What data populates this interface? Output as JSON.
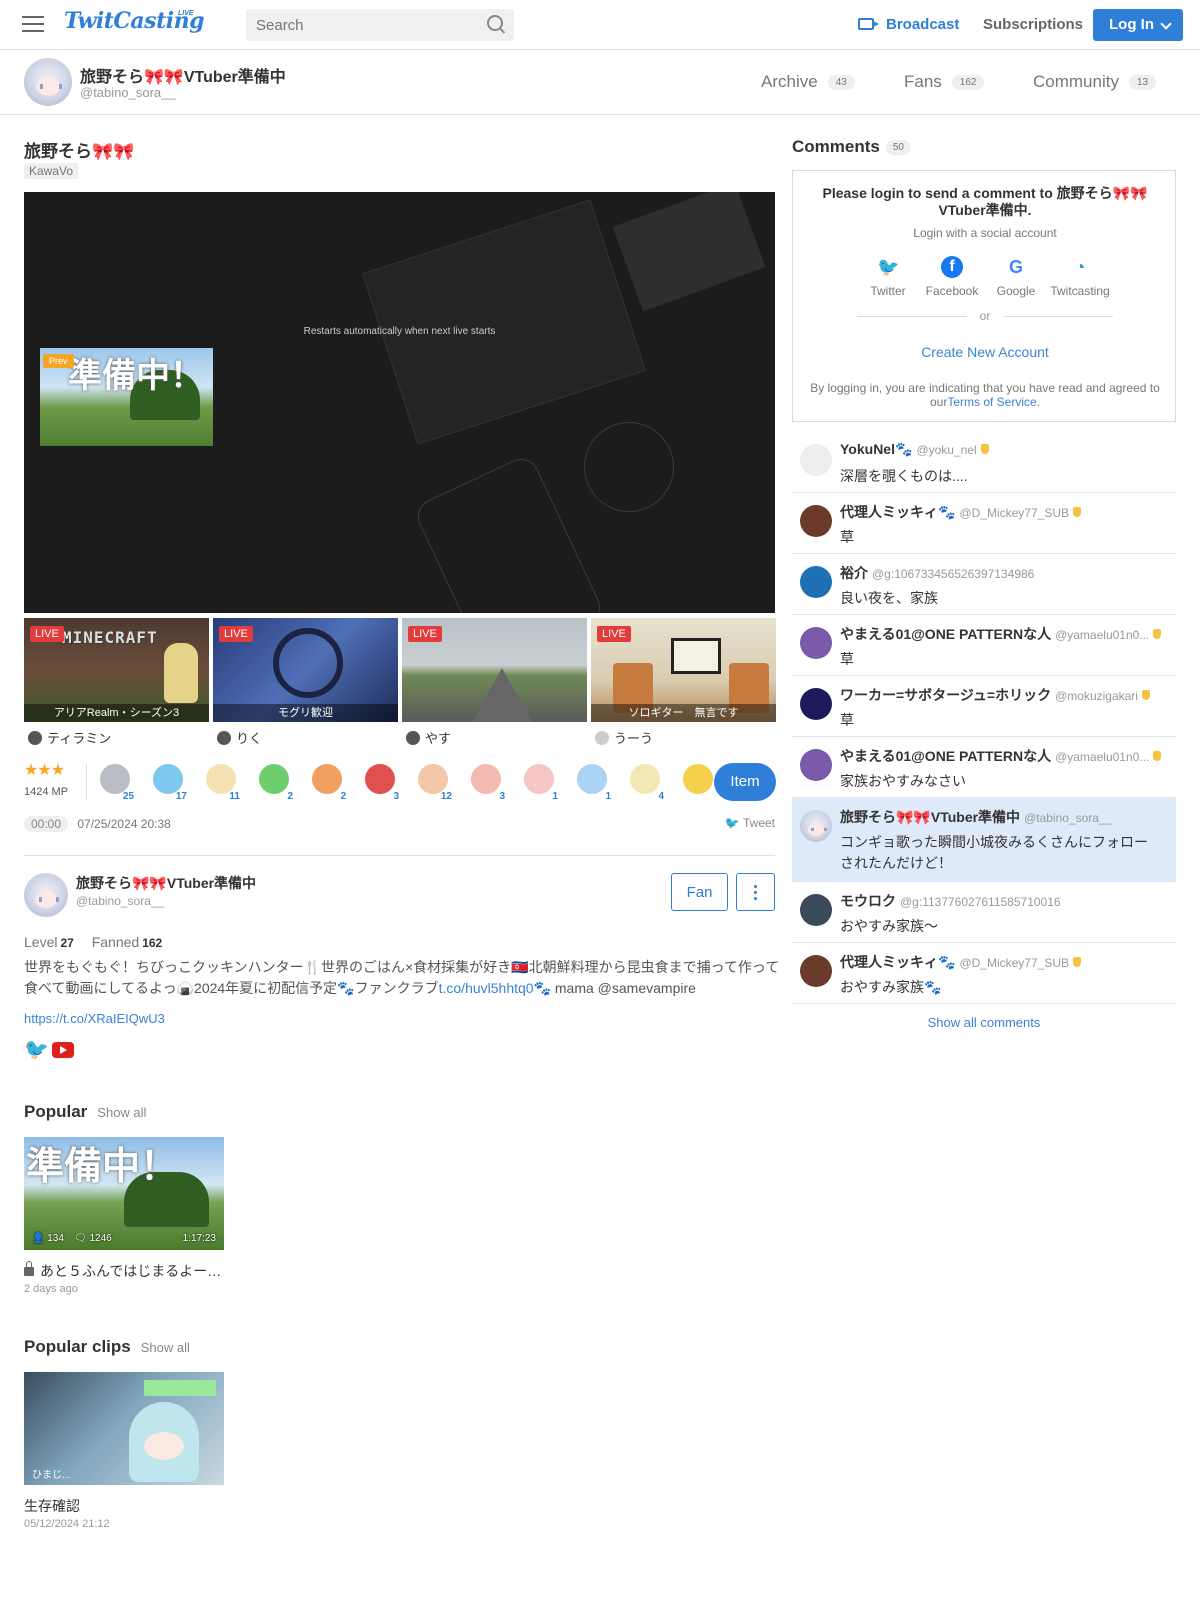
{
  "header": {
    "logo": "TwitCasting",
    "logo_sup": "LIVE",
    "search_placeholder": "Search",
    "broadcast": "Broadcast",
    "subscriptions": "Subscriptions",
    "login": "Log In"
  },
  "profile": {
    "name": "旅野そら🎀🎀VTuber準備中",
    "handle": "@tabino_sora__",
    "tabs": [
      {
        "label": "Archive",
        "count": "43"
      },
      {
        "label": "Fans",
        "count": "162"
      },
      {
        "label": "Community",
        "count": "13"
      }
    ]
  },
  "movie": {
    "title": "旅野そら🎀🎀",
    "tag": "KawaVo",
    "restart_msg": "Restarts automatically when next live starts",
    "prev_badge": "Prev",
    "prev_overlay": "準備中！"
  },
  "lives": [
    {
      "badge": "LIVE",
      "caption": "アリアRealm・シーズン3",
      "logo": "MINECRAFT",
      "user": "ティラミン"
    },
    {
      "badge": "LIVE",
      "caption": "モグリ歓迎",
      "user": "りく"
    },
    {
      "badge": "LIVE",
      "caption": "",
      "user": "やす"
    },
    {
      "badge": "LIVE",
      "caption": "ソロギター　無言です",
      "user": "うーう"
    }
  ],
  "gifts": {
    "stars": "★★★",
    "mp": "1424 MP",
    "items": [
      {
        "count": "25",
        "color": "#b9bec4"
      },
      {
        "count": "17",
        "color": "#7ec8f0"
      },
      {
        "count": "11",
        "color": "#f4e3b0"
      },
      {
        "count": "2",
        "color": "#6fcf6f"
      },
      {
        "count": "2",
        "color": "#f0a060"
      },
      {
        "count": "3",
        "color": "#e05050"
      },
      {
        "count": "12",
        "color": "#f3c7a8"
      },
      {
        "count": "3",
        "color": "#f4b9b0"
      },
      {
        "count": "1",
        "color": "#f6c6c6"
      },
      {
        "count": "1",
        "color": "#a9d2f5"
      },
      {
        "count": "4",
        "color": "#f4e7b6"
      },
      {
        "count": "",
        "color": "#f5d04a"
      }
    ],
    "item_button": "Item"
  },
  "meta": {
    "time": "00:00",
    "date": "07/25/2024 20:38",
    "tweet": "Tweet"
  },
  "user": {
    "name": "旅野そら🎀🎀VTuber準備中",
    "handle": "@tabino_sora__",
    "fan_button": "Fan",
    "level_label": "Level",
    "level": "27",
    "fanned_label": "Fanned",
    "fanned": "162",
    "bio_line1": "世界をもぐもぐ！ちびっこクッキンハンター🍴世界のごはん×食材採集が好き🇰🇵北朝鮮料理から昆虫食まで捕って作って",
    "bio_line2_a": "食べて動画にしてるよっ🍙2024年夏に初配信予定🐾ファンクラブ",
    "bio_link_inline": "t.co/huvl5hhtq0",
    "bio_line2_b": "🐾 mama @samevampire",
    "link": "https://t.co/XRaIEIQwU3"
  },
  "popular": {
    "title": "Popular",
    "show_all": "Show all",
    "item": {
      "overlay": "準備中！",
      "viewers": "134",
      "comments": "1246",
      "duration": "1:17:23",
      "title": "あと５ふんではじまるよー…",
      "date": "2 days ago"
    }
  },
  "clips": {
    "title": "Popular clips",
    "show_all": "Show all",
    "item": {
      "overlay": "ひまじ...",
      "title": "生存確認",
      "date": "05/12/2024 21:12"
    }
  },
  "comments": {
    "title": "Comments",
    "count": "50",
    "login_title": "Please login to send a comment to 旅野そら🎀🎀VTuber準備中.",
    "login_sub": "Login with a social account",
    "socials": [
      {
        "label": "Twitter",
        "glyph": "🐦",
        "color": "#1da1f2"
      },
      {
        "label": "Facebook",
        "glyph": "f",
        "color": "#1877f2"
      },
      {
        "label": "Google",
        "glyph": "G",
        "color": "#4285f4"
      },
      {
        "label": "Twitcasting",
        "glyph": "◔",
        "color": "#2f9be0"
      }
    ],
    "or": "or",
    "create": "Create New Account",
    "terms_pre": "By logging in, you are indicating that you have read and agreed to our",
    "terms_link": "Terms of Service",
    "terms_post": ".",
    "items": [
      {
        "name": "YokuNel🐾",
        "handle": "@yoku_nel",
        "text": "深層を覗くものは....",
        "avatar": "#eeeeee",
        "medal": true
      },
      {
        "name": "代理人ミッキィ🐾",
        "handle": "@D_Mickey77_SUB",
        "text": "草",
        "avatar": "#6a3a2a",
        "medal": true
      },
      {
        "name": "裕介",
        "handle": "@g:106733456526397134986",
        "text": "良い夜を、家族",
        "avatar": "#1f6fb5",
        "medal": false
      },
      {
        "name": "やまえる01@ONE PATTERNな人",
        "handle": "@yamaelu01n0...",
        "text": "草",
        "avatar": "#7a5aa8",
        "medal": true
      },
      {
        "name": "ワーカー=サボタージュ=ホリック",
        "handle": "@mokuzigakari",
        "text": "草",
        "avatar": "#1c1c5a",
        "medal": true
      },
      {
        "name": "やまえる01@ONE PATTERNな人",
        "handle": "@yamaelu01n0...",
        "text": "家族おやすみなさい",
        "avatar": "#7a5aa8",
        "medal": true
      },
      {
        "name": "旅野そら🎀🎀VTuber準備中",
        "handle": "@tabino_sora__",
        "text": "コンギョ歌った瞬間小城夜みるくさんにフォローされたんだけど！",
        "avatar": "",
        "medal": false,
        "highlight": true
      },
      {
        "name": "モウロク",
        "handle": "@g:113776027611585710016",
        "text": "おやすみ家族〜",
        "avatar": "#3a4a5a",
        "medal": false
      },
      {
        "name": "代理人ミッキィ🐾",
        "handle": "@D_Mickey77_SUB",
        "text": "おやすみ家族🐾",
        "avatar": "#6a3a2a",
        "medal": true
      }
    ],
    "show_all": "Show all comments"
  }
}
